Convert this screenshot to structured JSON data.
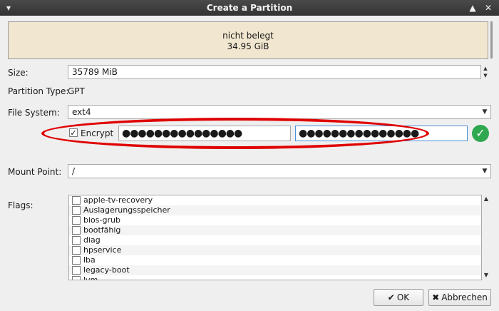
{
  "window": {
    "title": "Create a Partition"
  },
  "partition": {
    "line1": "nicht belegt",
    "line2": "34.95 GiB"
  },
  "size": {
    "label": "Size:",
    "value": "35789 MiB"
  },
  "partition_type": {
    "label": "Partition Type:",
    "value": "GPT"
  },
  "file_system": {
    "label": "File System:",
    "value": "ext4"
  },
  "encrypt": {
    "label": "Encrypt",
    "checked": true,
    "password": "●●●●●●●●●●●●●●●",
    "confirm": "●●●●●●●●●●●●●●●"
  },
  "mount_point": {
    "label": "Mount Point:",
    "value": "/"
  },
  "flags": {
    "label": "Flags:",
    "items": [
      "apple-tv-recovery",
      "Auslagerungsspeicher",
      "bios-grub",
      "bootfähig",
      "diag",
      "hpservice",
      "lba",
      "legacy-boot",
      "lvm"
    ]
  },
  "buttons": {
    "ok": "OK",
    "cancel": "Abbrechen"
  },
  "colors": {
    "highlight": "#e00000",
    "success": "#2fa84f"
  }
}
